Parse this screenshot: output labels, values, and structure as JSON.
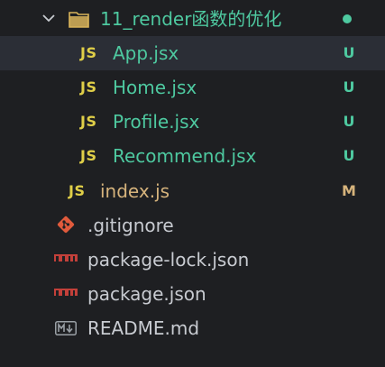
{
  "colors": {
    "untracked": "#4ec9a0",
    "modified": "#d6b37c",
    "plain": "#c8cbd1",
    "js_icon": "#e0cf48",
    "selected_bg": "#2b2e36",
    "git_icon": "#e05a3c",
    "npm_icon": "#c3403a",
    "md_icon": "#9aa0a6"
  },
  "folder": {
    "name": "11_render函数的优化",
    "expanded": true,
    "icon": "folder-open-icon",
    "status_dot": true
  },
  "files": [
    {
      "icon": "JS",
      "icon_name": "js-icon",
      "name": "App.jsx",
      "status": "U",
      "selected": true
    },
    {
      "icon": "JS",
      "icon_name": "js-icon",
      "name": "Home.jsx",
      "status": "U",
      "selected": false
    },
    {
      "icon": "JS",
      "icon_name": "js-icon",
      "name": "Profile.jsx",
      "status": "U",
      "selected": false
    },
    {
      "icon": "JS",
      "icon_name": "js-icon",
      "name": "Recommend.jsx",
      "status": "U",
      "selected": false
    }
  ],
  "root_files": [
    {
      "icon": "JS",
      "icon_name": "js-icon",
      "name": "index.js",
      "status": "M"
    },
    {
      "icon_name": "git-icon",
      "name": ".gitignore",
      "status": ""
    },
    {
      "icon_name": "npm-icon",
      "name": "package-lock.json",
      "status": ""
    },
    {
      "icon_name": "npm-icon",
      "name": "package.json",
      "status": ""
    },
    {
      "icon_name": "markdown-icon",
      "name": "README.md",
      "status": ""
    }
  ]
}
